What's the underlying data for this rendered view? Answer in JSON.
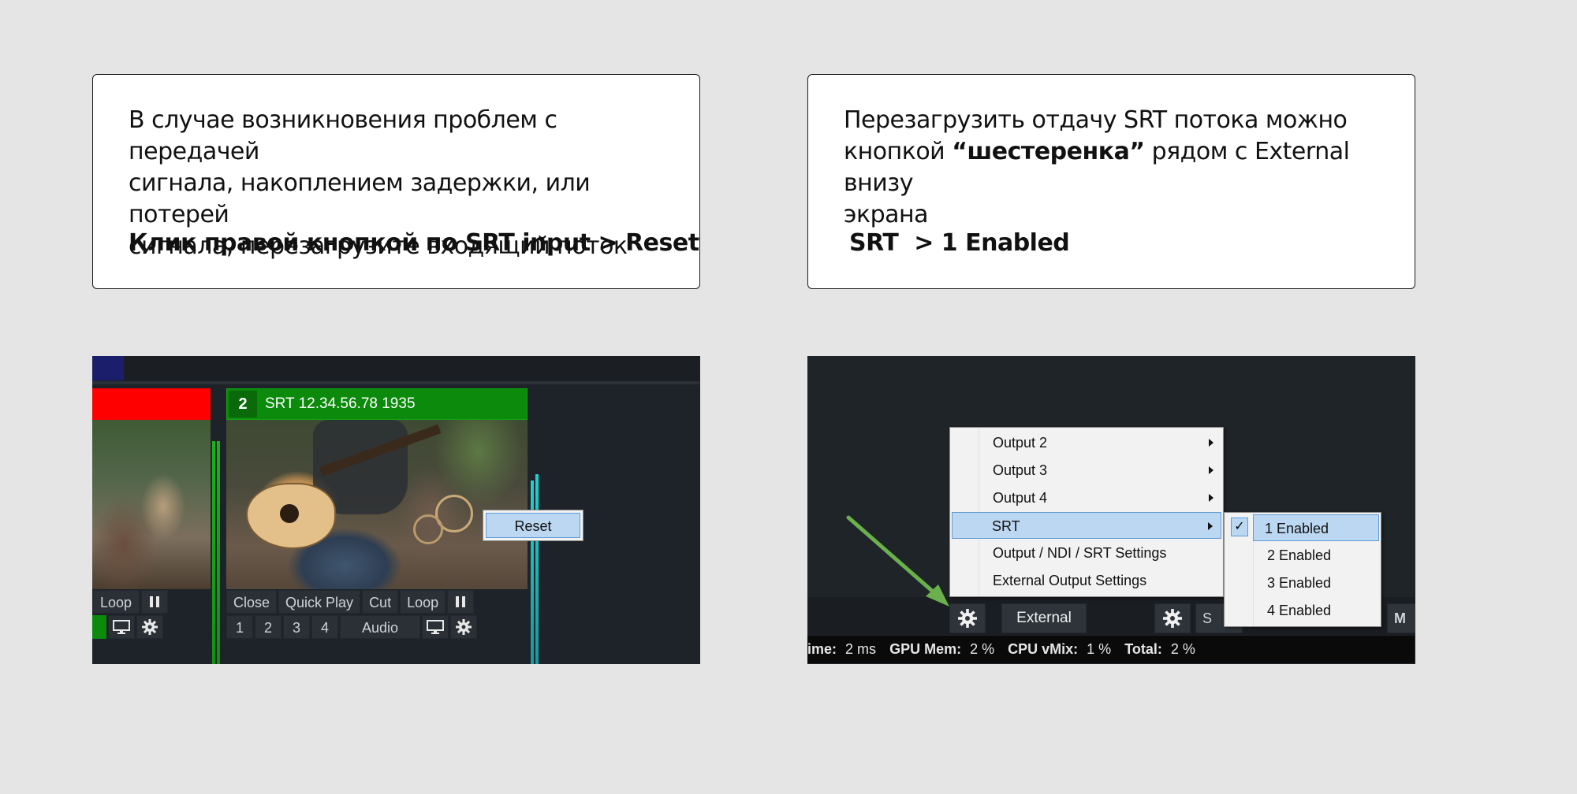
{
  "left_card": {
    "line1": "В случае возникновения проблем с передачей",
    "line2": "сигнала, накоплением задержки, или потерей",
    "line3": "сигнала, перезагрузите входящий поток",
    "instruction": "Клик правой кнопкой по SRT input > Reset"
  },
  "right_card": {
    "line1": "Перезагрузить отдачу SRT потока можно",
    "line2_pre": "кнопкой ",
    "line2_bold": "“шестеренка”",
    "line2_post": " рядом с External внизу",
    "line3": "экрана",
    "instruction": "SRT  > 1 Enabled"
  },
  "left_screenshot": {
    "input_number": "2",
    "input_title": "SRT 12.34.56.78 1935",
    "left_controls_row1": [
      "Loop"
    ],
    "controls_row1": [
      "Close",
      "Quick Play",
      "Cut",
      "Loop"
    ],
    "controls_row2": [
      "1",
      "2",
      "3",
      "4",
      "Audio"
    ],
    "context_menu_item": "Reset",
    "icons": [
      "pause-icon",
      "monitor-icon",
      "gear-icon"
    ]
  },
  "right_screenshot": {
    "menu_items": [
      "Output 2",
      "Output 3",
      "Output 4",
      "SRT",
      "Output / NDI / SRT Settings",
      "External Output Settings"
    ],
    "submenu_items": [
      "1 Enabled",
      "2 Enabled",
      "3 Enabled",
      "4 Enabled"
    ],
    "checked_item": "1 Enabled",
    "toolbar_external": "External",
    "toolbar_partial_s": "S",
    "toolbar_partial_m": "M",
    "status": {
      "time_label": "ime:",
      "time_value": "2 ms",
      "gpu_label": "GPU Mem:",
      "gpu_value": "2 %",
      "cpu_label": "CPU vMix:",
      "cpu_value": "1 %",
      "total_label": "Total:",
      "total_value": "2 %"
    },
    "arrow_color": "#6ab04c"
  },
  "colors": {
    "page_bg": "#e5e5e5",
    "app_bg": "#1e2329",
    "srt_green": "#0b8a0b",
    "highlight": "#bcd7f2"
  }
}
